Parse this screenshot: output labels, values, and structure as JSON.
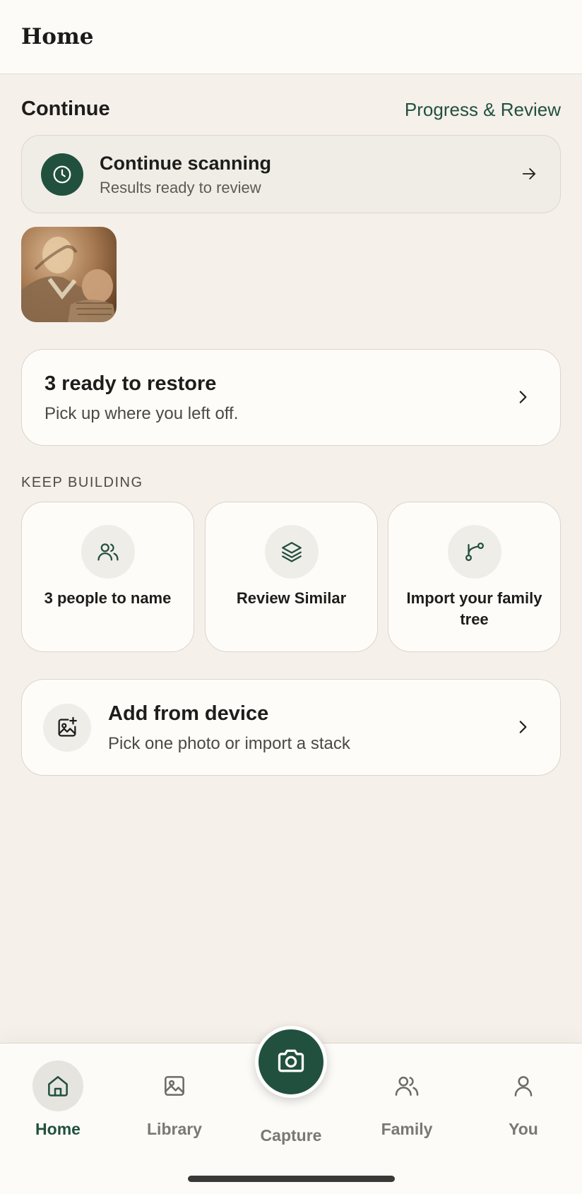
{
  "header": {
    "title": "Home"
  },
  "continue_section": {
    "title": "Continue",
    "link_label": "Progress & Review",
    "scan_card": {
      "title": "Continue scanning",
      "subtitle": "Results ready to review"
    }
  },
  "restore_card": {
    "title": "3 ready to restore",
    "subtitle": "Pick up where you left off."
  },
  "keep_building": {
    "label": "KEEP BUILDING",
    "tiles": [
      {
        "label": "3 people to name",
        "icon": "people-icon"
      },
      {
        "label": "Review Similar",
        "icon": "layers-icon"
      },
      {
        "label": "Import your family tree",
        "icon": "branch-icon"
      }
    ]
  },
  "device_card": {
    "title": "Add from device",
    "subtitle": "Pick one photo or import a stack"
  },
  "tabbar": {
    "tabs": [
      {
        "label": "Home",
        "icon": "home-icon",
        "active": true
      },
      {
        "label": "Library",
        "icon": "image-icon",
        "active": false
      },
      {
        "label": "Capture",
        "icon": "camera-icon",
        "active": false
      },
      {
        "label": "Family",
        "icon": "people-icon",
        "active": false
      },
      {
        "label": "You",
        "icon": "person-icon",
        "active": false
      }
    ]
  },
  "colors": {
    "accent": "#22503f",
    "background": "#f5f0ea",
    "card": "#fdfcf9"
  }
}
